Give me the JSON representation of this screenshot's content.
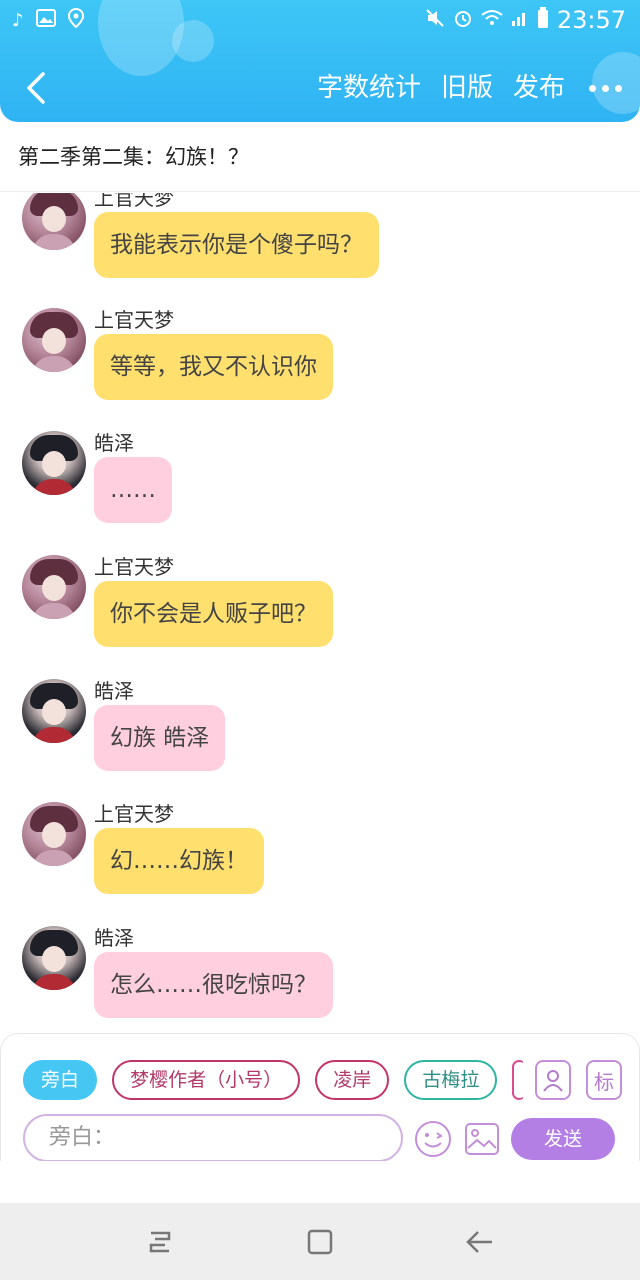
{
  "status_bar": {
    "time": "23:57",
    "left_icons": [
      "tiktok-icon",
      "image-icon",
      "location-icon"
    ],
    "right_icons": [
      "mute-icon",
      "alarm-icon",
      "wifi-icon",
      "signal-icon",
      "battery-icon"
    ]
  },
  "header": {
    "back_icon": "back-arrow-icon",
    "actions": {
      "word_count": "字数统计",
      "old_version": "旧版",
      "publish": "发布"
    },
    "more_icon": "more-dots-icon"
  },
  "episode": {
    "title": "第二季第二集：幻族！？"
  },
  "messages": [
    {
      "sender": "上官天梦",
      "text": "我能表示你是个傻子吗？",
      "style": "yellow"
    },
    {
      "sender": "上官天梦",
      "text": "等等，我又不认识你",
      "style": "yellow"
    },
    {
      "sender": "皓泽",
      "text": "……",
      "style": "pink"
    },
    {
      "sender": "上官天梦",
      "text": "你不会是人贩子吧？",
      "style": "yellow"
    },
    {
      "sender": "皓泽",
      "text": "幻族 皓泽",
      "style": "pink"
    },
    {
      "sender": "上官天梦",
      "text": "幻……幻族！",
      "style": "yellow"
    },
    {
      "sender": "皓泽",
      "text": "怎么……很吃惊吗？",
      "style": "pink"
    }
  ],
  "composer": {
    "chips": [
      "旁白",
      "梦樱作者（小号）",
      "凌岸",
      "古梅拉"
    ],
    "tag_button": "标",
    "input_placeholder": "旁白：",
    "send": "发送"
  },
  "nav": {
    "recent_icon": "recent-apps-icon",
    "home_icon": "home-icon",
    "back_icon": "back-icon"
  },
  "colors": {
    "header": "#2fb3f3",
    "bubble_yellow": "#ffdf6e",
    "bubble_pink": "#ffcfe0",
    "send_button": "#b47fe5"
  }
}
